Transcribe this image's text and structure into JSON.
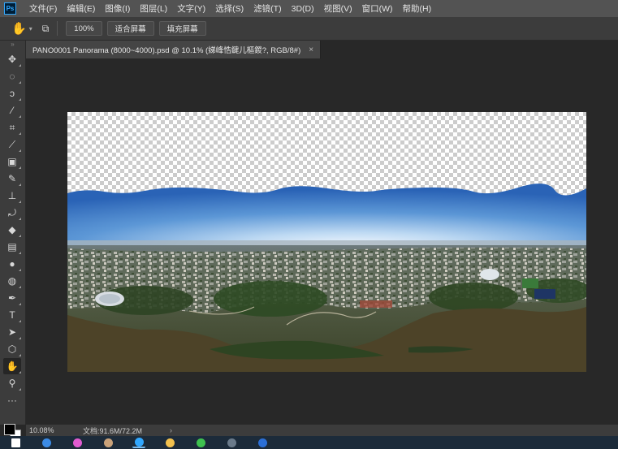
{
  "menubar": {
    "logo": "Ps",
    "items": [
      {
        "label": "文件(F)"
      },
      {
        "label": "编辑(E)"
      },
      {
        "label": "图像(I)"
      },
      {
        "label": "图层(L)"
      },
      {
        "label": "文字(Y)"
      },
      {
        "label": "选择(S)"
      },
      {
        "label": "滤镜(T)"
      },
      {
        "label": "3D(D)"
      },
      {
        "label": "视图(V)"
      },
      {
        "label": "窗口(W)"
      },
      {
        "label": "帮助(H)"
      }
    ]
  },
  "options": {
    "tool_icon": "hand-icon",
    "zoom_button": "100%",
    "fit_button": "适合屏幕",
    "fill_button": "填充屏幕"
  },
  "tools": [
    {
      "name": "move-tool-icon",
      "glyph": "✥"
    },
    {
      "name": "marquee-tool-icon",
      "glyph": "◌"
    },
    {
      "name": "lasso-tool-icon",
      "glyph": "ↄ"
    },
    {
      "name": "magic-wand-tool-icon",
      "glyph": "⁄"
    },
    {
      "name": "crop-tool-icon",
      "glyph": "⌗"
    },
    {
      "name": "eyedropper-tool-icon",
      "glyph": "⟋"
    },
    {
      "name": "healing-brush-tool-icon",
      "glyph": "▣"
    },
    {
      "name": "brush-tool-icon",
      "glyph": "✎"
    },
    {
      "name": "clone-stamp-tool-icon",
      "glyph": "⊥"
    },
    {
      "name": "history-brush-tool-icon",
      "glyph": "⤾"
    },
    {
      "name": "eraser-tool-icon",
      "glyph": "◆"
    },
    {
      "name": "gradient-tool-icon",
      "glyph": "▤"
    },
    {
      "name": "blur-tool-icon",
      "glyph": "●"
    },
    {
      "name": "dodge-tool-icon",
      "glyph": "◍"
    },
    {
      "name": "pen-tool-icon",
      "glyph": "✒"
    },
    {
      "name": "type-tool-icon",
      "glyph": "T"
    },
    {
      "name": "path-selection-tool-icon",
      "glyph": "➤"
    },
    {
      "name": "shape-tool-icon",
      "glyph": "⬡"
    },
    {
      "name": "hand-tool-icon",
      "glyph": "✋",
      "active": true
    },
    {
      "name": "zoom-tool-icon",
      "glyph": "⚲"
    },
    {
      "name": "more-tools-icon",
      "glyph": "···"
    }
  ],
  "document": {
    "tab_title": "PANO0001 Panorama (8000~4000).psd @ 10.1% (娣峰悎鍵儿樞鍐?, RGB/8#)",
    "close_glyph": "×"
  },
  "status": {
    "zoom": "10.08%",
    "doc_info": "文档:91.6M/72.2M",
    "arrow": "›"
  },
  "taskbar": {
    "apps": [
      {
        "name": "windows-start-icon",
        "color": "#ffffff"
      },
      {
        "name": "edge-browser-icon",
        "color": "#3b8be6"
      },
      {
        "name": "colorful-app-icon",
        "color": "#e05bd0"
      },
      {
        "name": "user-avatar-app-icon",
        "color": "#c9a27a"
      },
      {
        "name": "photoshop-app-icon",
        "color": "#31a8ff",
        "active": true
      },
      {
        "name": "file-explorer-icon",
        "color": "#f2c14e"
      },
      {
        "name": "wechat-app-icon",
        "color": "#3ec24f"
      },
      {
        "name": "monitor-app-icon",
        "color": "#6a7a8a"
      },
      {
        "name": "word-app-icon",
        "color": "#2b6fd6"
      }
    ]
  },
  "colors": {
    "sky_top": "#2d6fc4",
    "sky_horizon": "#e8f2fb",
    "water": "#4d4328",
    "vegetation": "#2f4a26"
  }
}
